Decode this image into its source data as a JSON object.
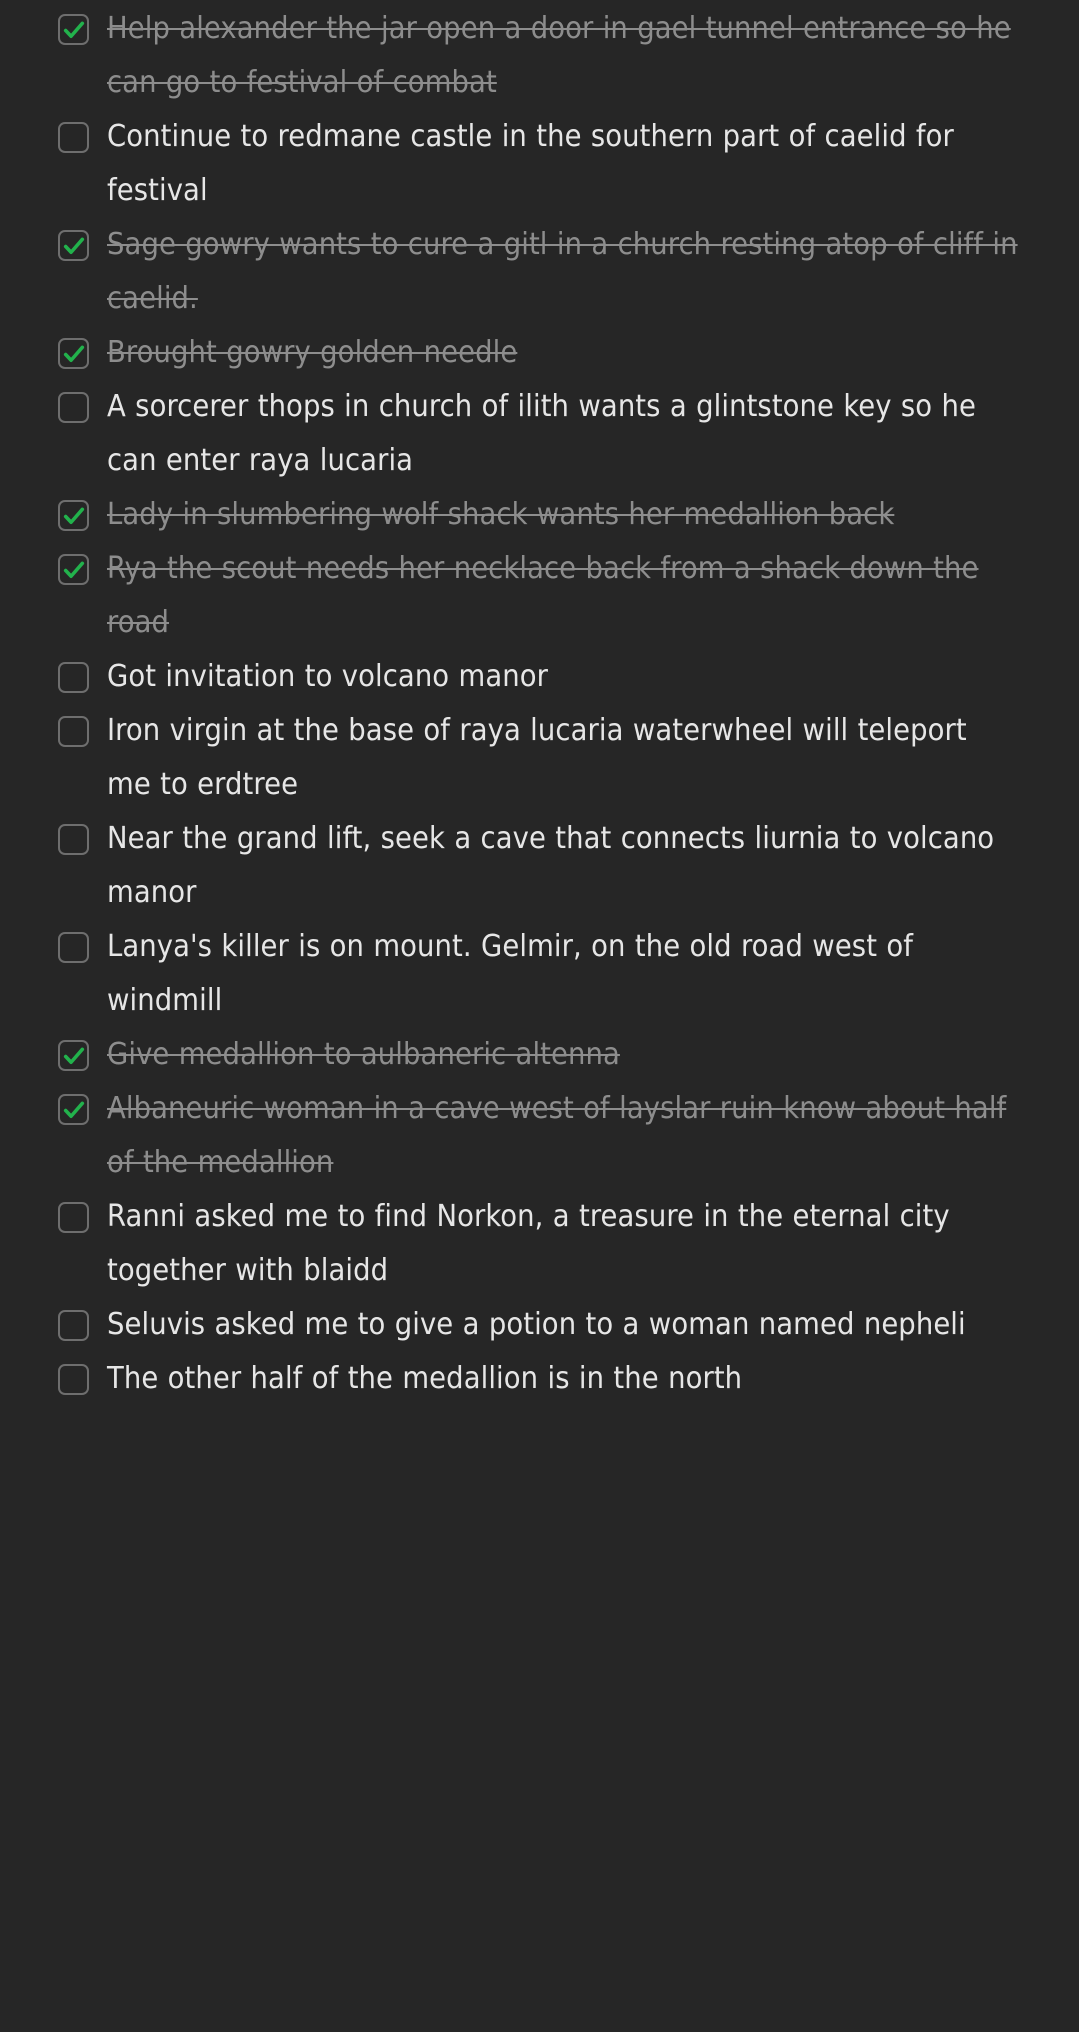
{
  "theme": {
    "background": "#262626",
    "text_active": "#e6e6e6",
    "text_completed": "#8d8d8d",
    "checkbox_border": "#6e6e6e",
    "checkmark": "#22b24c"
  },
  "checklist": {
    "items": [
      {
        "text": "Help alexander the jar open a door in gael tunnel entrance so he can go to festival of combat",
        "done": true
      },
      {
        "text": "Continue to redmane castle in the southern part of caelid for festival",
        "done": false
      },
      {
        "text": "Sage gowry wants to cure a gitl in a church resting atop of cliff in caelid.",
        "done": true
      },
      {
        "text": "Brought gowry golden needle",
        "done": true
      },
      {
        "text": "A sorcerer thops in church of ilith wants a glintstone key so he can enter raya lucaria",
        "done": false
      },
      {
        "text": "Lady in slumbering wolf shack wants her medallion back",
        "done": true
      },
      {
        "text": "Rya the scout needs her necklace back from a shack down the road",
        "done": true
      },
      {
        "text": "Got invitation to volcano manor",
        "done": false
      },
      {
        "text": "Iron virgin at the base of raya lucaria waterwheel will teleport me to erdtree",
        "done": false
      },
      {
        "text": "Near the grand lift, seek a cave that connects liurnia to volcano manor",
        "done": false
      },
      {
        "text": "Lanya's killer is on mount. Gelmir, on the old road west of windmill",
        "done": false
      },
      {
        "text": "Give medallion to aulbaneric altenna",
        "done": true
      },
      {
        "text": "Albaneuric woman in a cave west of layslar ruin know about half of the medallion",
        "done": true
      },
      {
        "text": "Ranni asked me to find Norkon, a treasure in the eternal city together with blaidd",
        "done": false
      },
      {
        "text": "Seluvis asked me to give a potion to a woman named nepheli",
        "done": false
      },
      {
        "text": "The other half of the medallion is in the north",
        "done": false
      }
    ],
    "checkmark_icon": "check-icon",
    "checkbox_icon": "checkbox-icon"
  }
}
